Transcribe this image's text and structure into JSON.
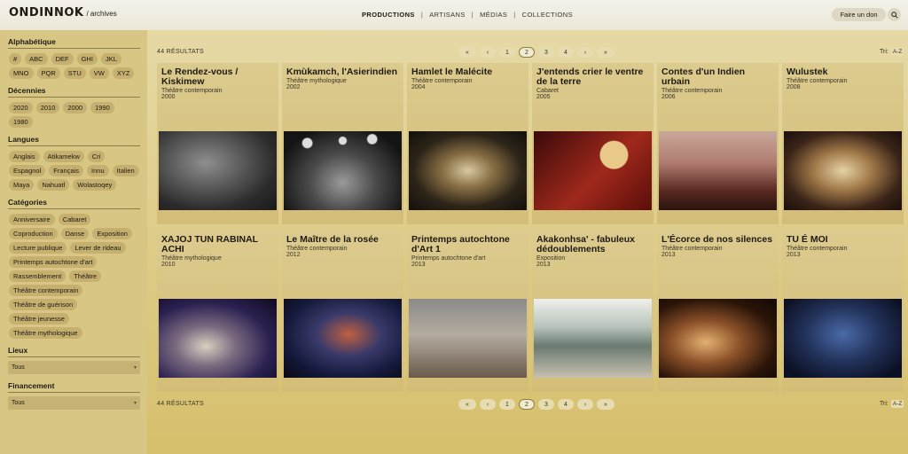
{
  "header": {
    "logo": "ONDINNOK",
    "logo_sub": "/ archives",
    "nav": [
      "PRODUCTIONS",
      "ARTISANS",
      "MÉDIAS",
      "COLLECTIONS"
    ],
    "donate_label": "Faire un don"
  },
  "sidebar": {
    "alpha_title": "Alphabétique",
    "alpha": [
      "#",
      "ABC",
      "DEF",
      "GHI",
      "JKL",
      "MNO",
      "PQR",
      "STU",
      "VW",
      "XYZ"
    ],
    "decades_title": "Décennies",
    "decades": [
      "2020",
      "2010",
      "2000",
      "1990",
      "1980"
    ],
    "languages_title": "Langues",
    "languages": [
      "Anglais",
      "Atikamekw",
      "Cri",
      "Espagnol",
      "Français",
      "Innu",
      "Italien",
      "Maya",
      "Nahuatl",
      "Wolastoqey"
    ],
    "categories_title": "Catégories",
    "categories": [
      "Anniversaire",
      "Cabaret",
      "Coproduction",
      "Danse",
      "Exposition",
      "Lecture publique",
      "Lever de rideau",
      "Printemps autochtone d'art",
      "Rassemblement",
      "Théâtre",
      "Théâtre contemporain",
      "Théâtre de guérison",
      "Théâtre jeunesse",
      "Théâtre mythologique"
    ],
    "places_title": "Lieux",
    "places_value": "Tous",
    "funding_title": "Financement",
    "funding_value": "Tous"
  },
  "main": {
    "results_label": "44 RÉSULTATS",
    "pager": [
      "«",
      "‹",
      "1",
      "2",
      "3",
      "4",
      "›",
      "»"
    ],
    "current_page": "2",
    "sort_label": "Tri:",
    "sort_value": "A-Z"
  },
  "cards": [
    {
      "title": "Le Rendez-vous / Kiskimew",
      "category": "Théâtre contemporain",
      "year": "2000",
      "img": "bw1"
    },
    {
      "title": "Kmùkamch, l'Asierindien",
      "category": "Théâtre mythologique",
      "year": "2002",
      "img": "bw2"
    },
    {
      "title": "Hamlet le Malécite",
      "category": "Théâtre contemporain",
      "year": "2004",
      "img": "c1"
    },
    {
      "title": "J'entends crier le ventre de la terre",
      "category": "Cabaret",
      "year": "2005",
      "img": "c2"
    },
    {
      "title": "Contes d'un Indien urbain",
      "category": "Théâtre contemporain",
      "year": "2006",
      "img": "c3"
    },
    {
      "title": "Wulustek",
      "category": "Théâtre contemporain",
      "year": "2008",
      "img": "c4"
    },
    {
      "title": "XAJOJ TUN RABINAL ACHI",
      "category": "Théâtre mythologique",
      "year": "2010",
      "img": "c5"
    },
    {
      "title": "Le Maître de la rosée",
      "category": "Théâtre contemporain",
      "year": "2012",
      "img": "c6"
    },
    {
      "title": "Printemps autochtone d'Art 1",
      "category": "Printemps autochtone d'art",
      "year": "2013",
      "img": "c7"
    },
    {
      "title": "Akakonhsa' - fabuleux dédoublements",
      "category": "Exposition",
      "year": "2013",
      "img": "c8"
    },
    {
      "title": "L'Écorce de nos silences",
      "category": "Théâtre contemporain",
      "year": "2013",
      "img": "c9"
    },
    {
      "title": "TU É MOI",
      "category": "Théâtre contemporain",
      "year": "2013",
      "img": "c10"
    }
  ],
  "colors": {
    "sidebar": "#d8c684",
    "chip": "#c5b070",
    "header": "#efece0"
  }
}
